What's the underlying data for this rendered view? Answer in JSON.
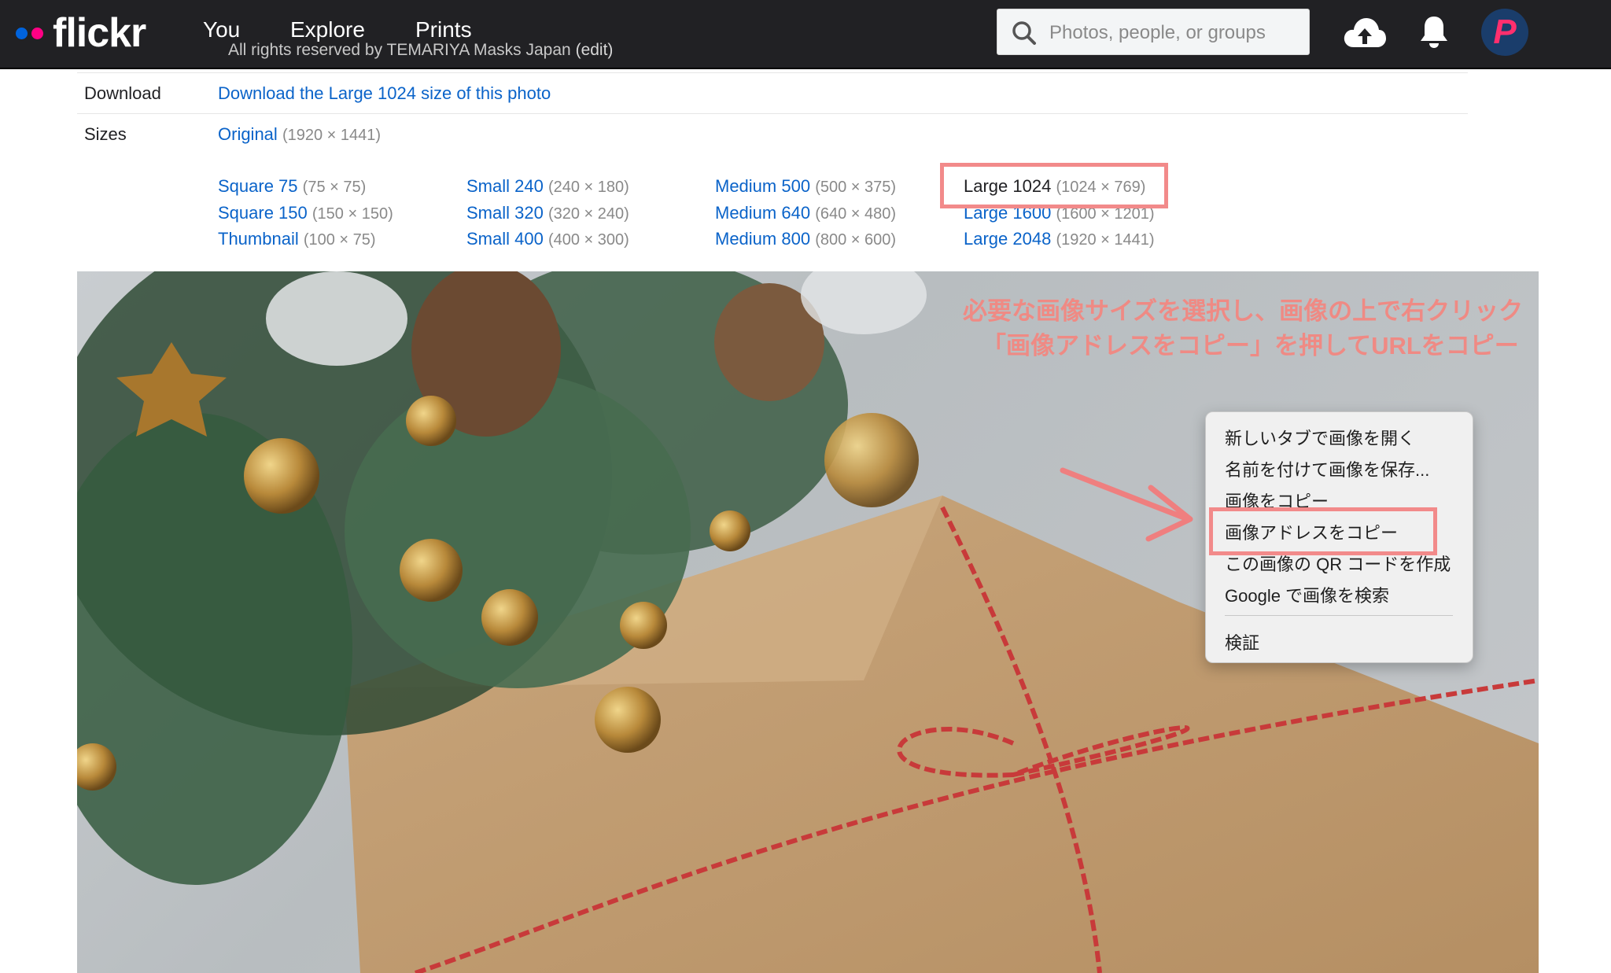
{
  "nav": {
    "logo_text": "flickr",
    "links": [
      "You",
      "Explore",
      "Prints"
    ],
    "search_placeholder": "Photos, people, or groups",
    "icons": [
      "search-icon",
      "upload-cloud-icon",
      "bell-icon",
      "avatar"
    ],
    "avatar_letter": "P"
  },
  "ghost_line": {
    "text": "All rights reserved by TEMARIYA Masks Japan",
    "edit": "(edit)"
  },
  "download": {
    "label": "Download",
    "link": "Download the Large 1024 size of this photo"
  },
  "sizes": {
    "label": "Sizes",
    "original": {
      "name": "Original",
      "dims": "(1920 × 1441)"
    },
    "columns": [
      [
        {
          "name": "Square 75",
          "dims": "(75 × 75)"
        },
        {
          "name": "Square 150",
          "dims": "(150 × 150)"
        },
        {
          "name": "Thumbnail",
          "dims": "(100 × 75)"
        }
      ],
      [
        {
          "name": "Small 240",
          "dims": "(240 × 180)"
        },
        {
          "name": "Small 320",
          "dims": "(320 × 240)"
        },
        {
          "name": "Small 400",
          "dims": "(400 × 300)"
        }
      ],
      [
        {
          "name": "Medium 500",
          "dims": "(500 × 375)"
        },
        {
          "name": "Medium 640",
          "dims": "(640 × 480)"
        },
        {
          "name": "Medium 800",
          "dims": "(800 × 600)"
        }
      ],
      [
        {
          "name": "Large 1024",
          "dims": "(1024 × 769)",
          "selected": true
        },
        {
          "name": "Large 1600",
          "dims": "(1600 × 1201)"
        },
        {
          "name": "Large 2048",
          "dims": "(1920 × 1441)"
        }
      ]
    ]
  },
  "annotation": {
    "line1": "必要な画像サイズを選択し、画像の上で右クリック",
    "line2": "「画像アドレスをコピー」を押してURLをコピー",
    "color": "#ef8a84"
  },
  "context_menu": {
    "items": [
      "新しいタブで画像を開く",
      "名前を付けて画像を保存...",
      "画像をコピー",
      "画像アドレスをコピー",
      "この画像の QR コードを作成",
      "Google で画像を検索",
      "検証"
    ],
    "highlighted": "画像アドレスをコピー"
  },
  "colors": {
    "nav_bg": "#212124",
    "link": "#0a63c9",
    "highlight": "#f28a8a"
  }
}
